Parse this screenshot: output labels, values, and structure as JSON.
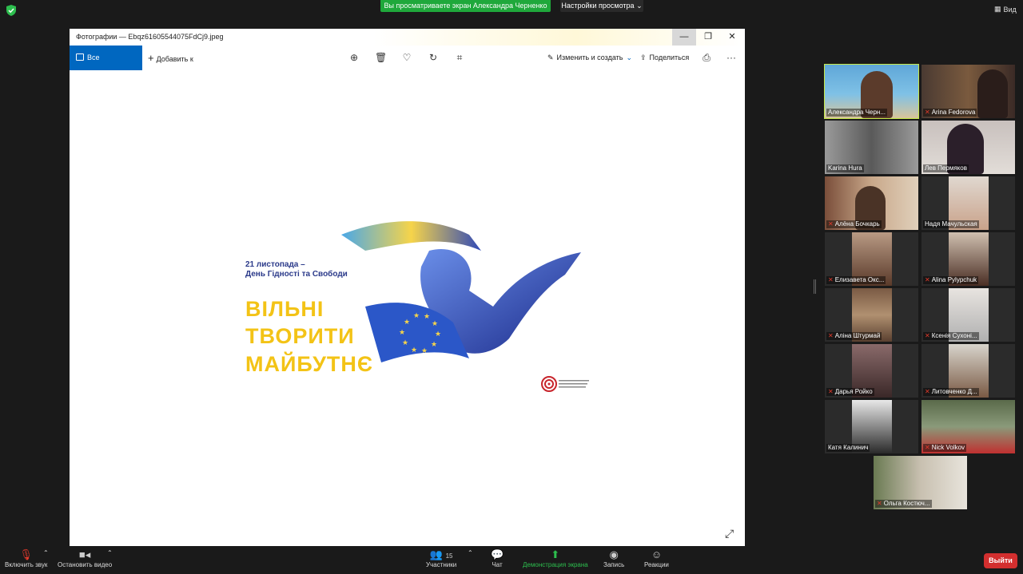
{
  "topbar": {
    "share_banner": "Вы просматриваете экран Александра Черненко",
    "view_settings": "Настройки просмотра",
    "view_button": "Вид"
  },
  "photos_window": {
    "title": "Фотографии — Ebqz61605544075FdCj9.jpeg",
    "all_photos": "Все фотографии",
    "add_to": "Добавить к",
    "edit_create": "Изменить и создать",
    "share": "Поделиться",
    "more": "···"
  },
  "image": {
    "date_line1": "21 листопада –",
    "date_line2": "День Гідності та Свободи",
    "headline1": "ВІЛЬНІ",
    "headline2": "ТВОРИТИ",
    "headline3": "МАЙБУТНЄ"
  },
  "participants": [
    {
      "name": "Александра Черн...",
      "muted": false,
      "active": true
    },
    {
      "name": "Arina Fedorova",
      "muted": true
    },
    {
      "name": "Karina Hura",
      "muted": false
    },
    {
      "name": "Лев Пермяков",
      "muted": false
    },
    {
      "name": "Алёна Бочкарь",
      "muted": true
    },
    {
      "name": "Надя Мачульская",
      "muted": false
    },
    {
      "name": "Елизавета Окс...",
      "muted": true
    },
    {
      "name": "Alina Pylypchuk",
      "muted": true
    },
    {
      "name": "Аліна Штурмай",
      "muted": true
    },
    {
      "name": "Ксенія Сухоні...",
      "muted": true
    },
    {
      "name": "Дарья Ройко",
      "muted": true
    },
    {
      "name": "Литовченко Д...",
      "muted": true
    },
    {
      "name": "Катя Калинич",
      "muted": false
    },
    {
      "name": "Nick Volkov",
      "muted": true
    },
    {
      "name": "Ольга Костюч...",
      "muted": true
    }
  ],
  "bottombar": {
    "unmute": "Включить звук",
    "stop_video": "Остановить видео",
    "participants": "Участники",
    "participants_count": "15",
    "chat": "Чат",
    "share_screen": "Демонстрация экрана",
    "record": "Запись",
    "reactions": "Реакции",
    "leave": "Выйти"
  }
}
